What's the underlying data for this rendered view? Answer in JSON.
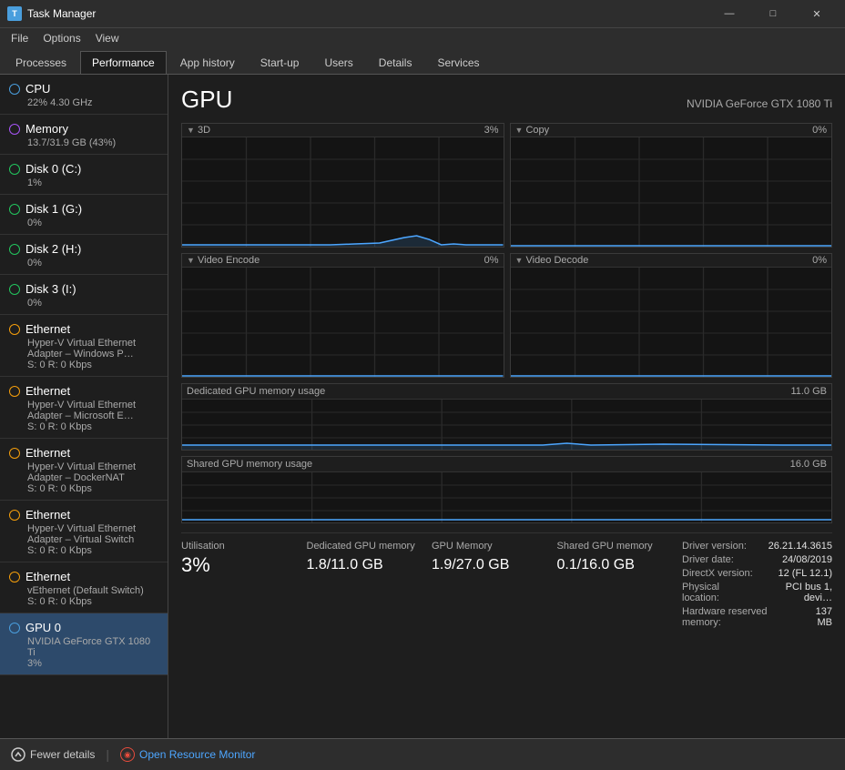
{
  "titlebar": {
    "title": "Task Manager",
    "minimize": "—",
    "maximize": "□",
    "close": "✕"
  },
  "menubar": {
    "items": [
      "File",
      "Options",
      "View"
    ]
  },
  "tabs": [
    {
      "label": "Processes",
      "active": false
    },
    {
      "label": "Performance",
      "active": true
    },
    {
      "label": "App history",
      "active": false
    },
    {
      "label": "Start-up",
      "active": false
    },
    {
      "label": "Users",
      "active": false
    },
    {
      "label": "Details",
      "active": false
    },
    {
      "label": "Services",
      "active": false
    }
  ],
  "sidebar": {
    "items": [
      {
        "name": "CPU",
        "dot": "blue",
        "line1": "22% 4.30 GHz",
        "line2": ""
      },
      {
        "name": "Memory",
        "dot": "purple",
        "line1": "13.7/31.9 GB (43%)",
        "line2": ""
      },
      {
        "name": "Disk 0 (C:)",
        "dot": "green",
        "line1": "1%",
        "line2": ""
      },
      {
        "name": "Disk 1 (G:)",
        "dot": "green",
        "line1": "0%",
        "line2": ""
      },
      {
        "name": "Disk 2 (H:)",
        "dot": "green",
        "line1": "0%",
        "line2": ""
      },
      {
        "name": "Disk 3 (I:)",
        "dot": "green",
        "line1": "0%",
        "line2": ""
      },
      {
        "name": "Ethernet",
        "dot": "orange",
        "line1": "Hyper-V Virtual Ethernet Adapter – Windows P…",
        "line2": "S: 0 R: 0 Kbps"
      },
      {
        "name": "Ethernet",
        "dot": "orange",
        "line1": "Hyper-V Virtual Ethernet Adapter – Microsoft E…",
        "line2": "S: 0 R: 0 Kbps"
      },
      {
        "name": "Ethernet",
        "dot": "orange",
        "line1": "Hyper-V Virtual Ethernet Adapter – DockerNAT",
        "line2": "S: 0 R: 0 Kbps"
      },
      {
        "name": "Ethernet",
        "dot": "orange",
        "line1": "Hyper-V Virtual Ethernet Adapter – Virtual Switch",
        "line2": "S: 0 R: 0 Kbps"
      },
      {
        "name": "Ethernet",
        "dot": "orange",
        "line1": "vEthernet (Default Switch)",
        "line2": "S: 0 R: 0 Kbps"
      },
      {
        "name": "GPU 0",
        "dot": "blue",
        "line1": "NVIDIA GeForce GTX 1080 Ti",
        "line2": "3%",
        "active": true
      }
    ]
  },
  "gpu": {
    "title": "GPU",
    "subtitle": "NVIDIA GeForce GTX 1080 Ti",
    "charts": [
      {
        "label": "3D",
        "percent": "3%",
        "side": "left"
      },
      {
        "label": "Copy",
        "percent": "0%",
        "side": "right"
      },
      {
        "label": "Video Encode",
        "percent": "0%",
        "side": "left"
      },
      {
        "label": "Video Decode",
        "percent": "0%",
        "side": "right"
      }
    ],
    "dedicated_label": "Dedicated GPU memory usage",
    "dedicated_max": "11.0 GB",
    "shared_label": "Shared GPU memory usage",
    "shared_max": "16.0 GB",
    "stats": {
      "utilisation_label": "Utilisation",
      "utilisation_value": "3%",
      "dedicated_mem_label": "Dedicated GPU memory",
      "dedicated_mem_value": "1.8/11.0 GB",
      "gpu_mem_label": "GPU Memory",
      "gpu_mem_value": "1.9/27.0 GB",
      "shared_mem_label": "Shared GPU memory",
      "shared_mem_value": "0.1/16.0 GB"
    },
    "info": {
      "driver_version_label": "Driver version:",
      "driver_version_value": "26.21.14.3615",
      "driver_date_label": "Driver date:",
      "driver_date_value": "24/08/2019",
      "directx_label": "DirectX version:",
      "directx_value": "12 (FL 12.1)",
      "physical_location_label": "Physical location:",
      "physical_location_value": "PCI bus 1, devi…",
      "hw_reserved_label": "Hardware reserved memory:",
      "hw_reserved_value": "137 MB"
    }
  },
  "bottombar": {
    "fewer_details": "Fewer details",
    "open_resource_monitor": "Open Resource Monitor"
  }
}
